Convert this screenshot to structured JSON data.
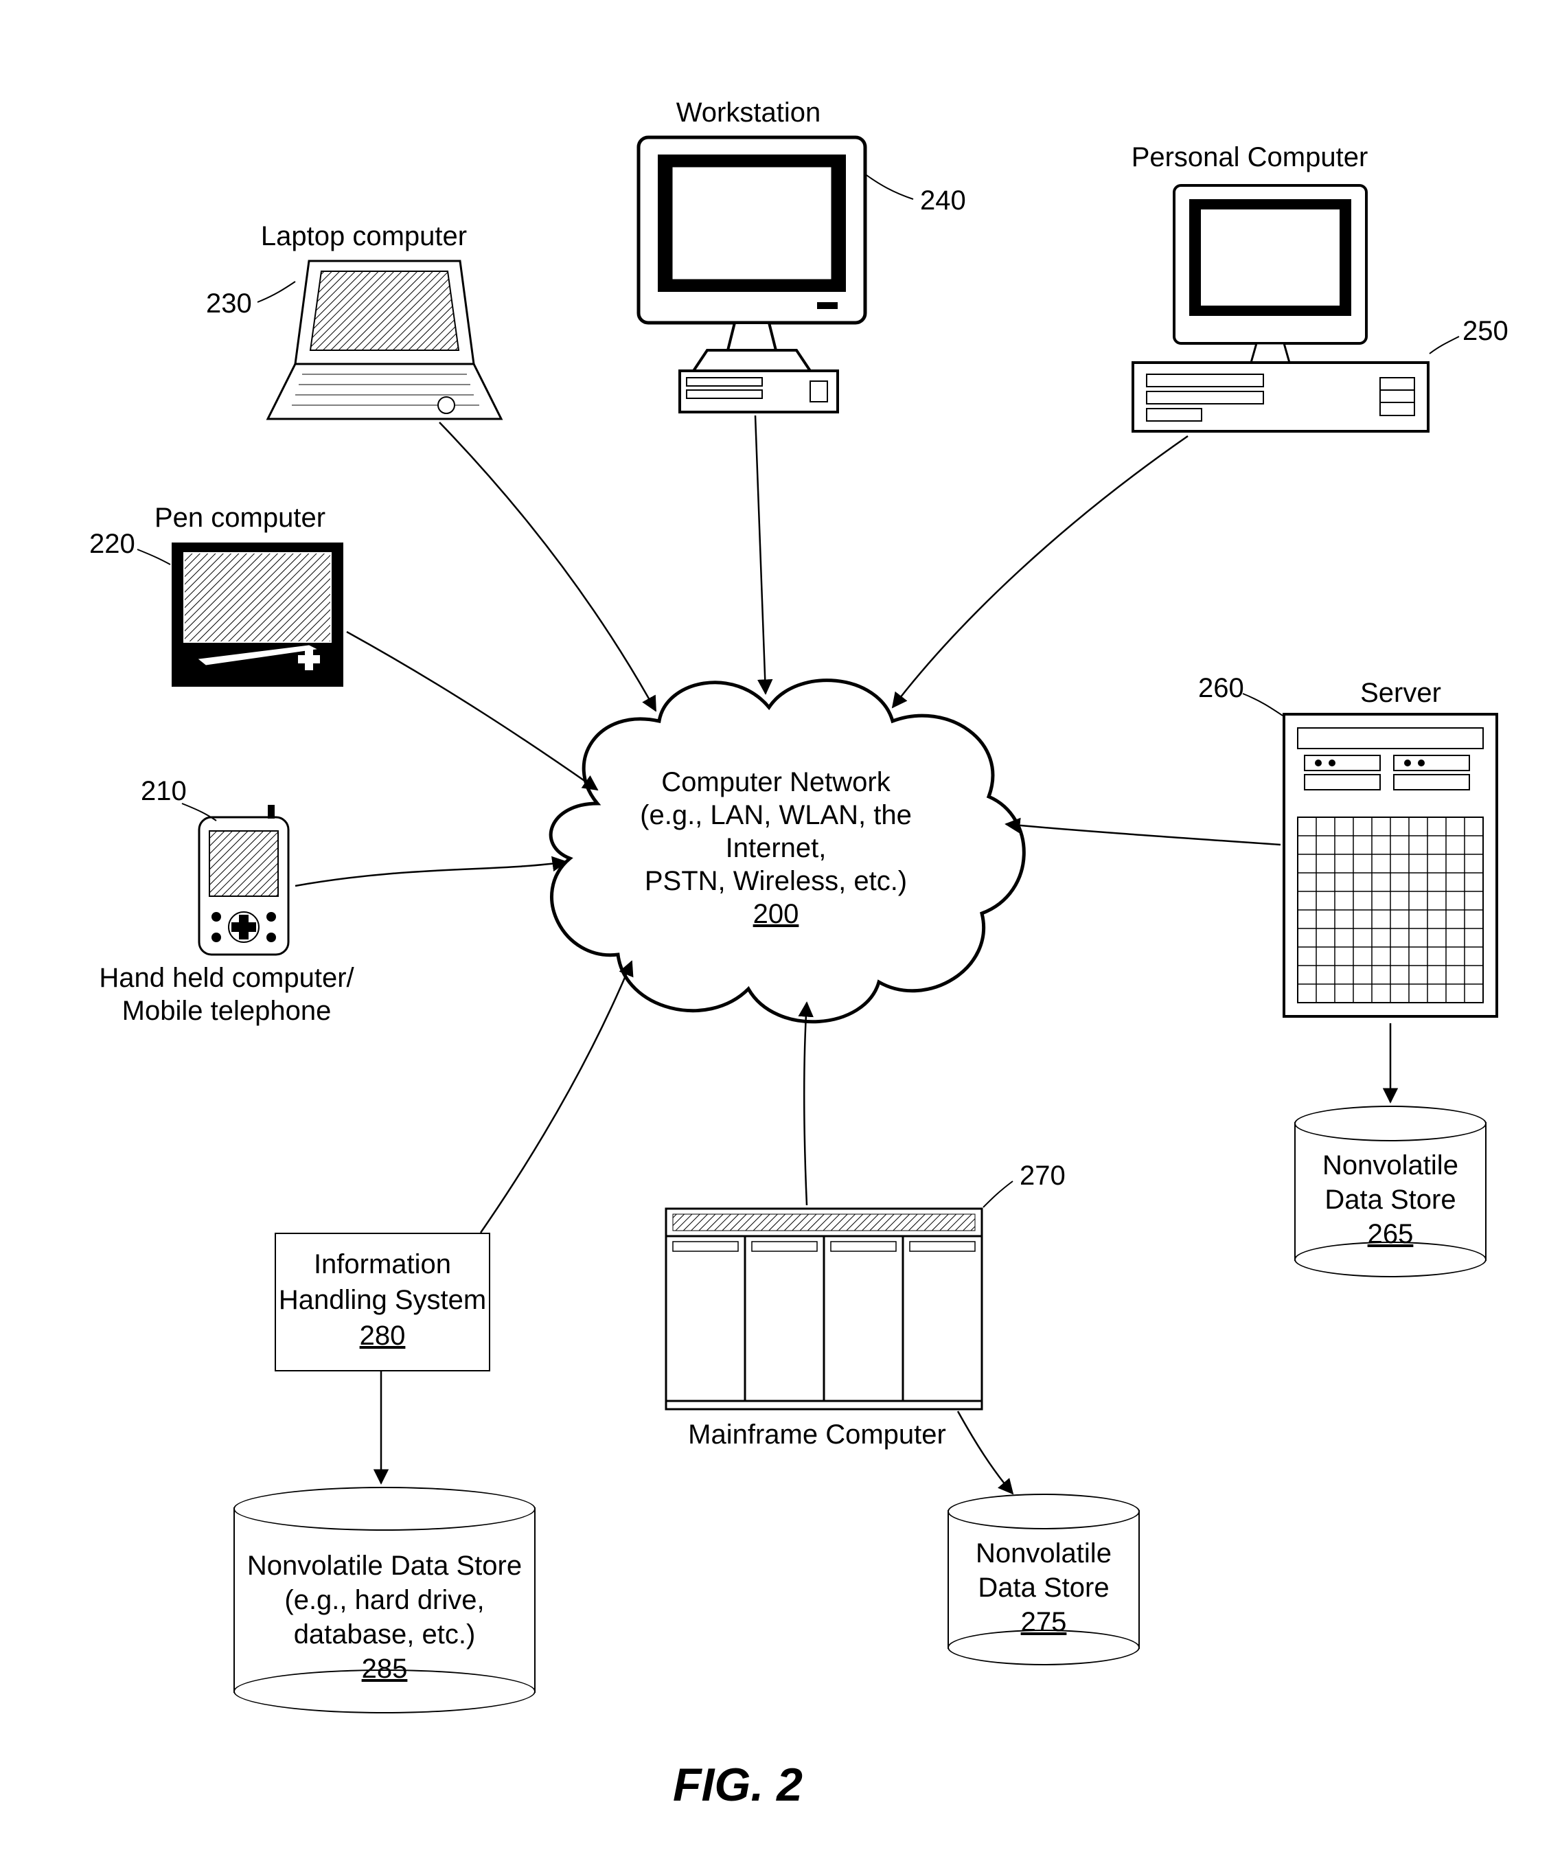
{
  "figure_caption": "FIG. 2",
  "cloud": {
    "line1": "Computer Network",
    "line2": "(e.g., LAN, WLAN, the Internet,",
    "line3": "PSTN, Wireless, etc.)",
    "ref": "200"
  },
  "nodes": {
    "handheld": {
      "label_line1": "Hand held computer/",
      "label_line2": "Mobile telephone",
      "ref": "210"
    },
    "pen": {
      "label": "Pen computer",
      "ref": "220"
    },
    "laptop": {
      "label": "Laptop computer",
      "ref": "230"
    },
    "workstation": {
      "label": "Workstation",
      "ref": "240"
    },
    "pc": {
      "label": "Personal Computer",
      "ref": "250"
    },
    "server": {
      "label": "Server",
      "ref": "260"
    },
    "mainframe": {
      "label": "Mainframe Computer",
      "ref": "270"
    },
    "ihs": {
      "line1": "Information",
      "line2": "Handling System",
      "ref": "280"
    }
  },
  "datastores": {
    "left": {
      "line1": "Nonvolatile Data Store",
      "line2": "(e.g., hard drive,",
      "line3": "database, etc.)",
      "ref": "285"
    },
    "mid": {
      "line1": "Nonvolatile",
      "line2": "Data Store",
      "ref": "275"
    },
    "right": {
      "line1": "Nonvolatile",
      "line2": "Data Store",
      "ref": "265"
    }
  }
}
